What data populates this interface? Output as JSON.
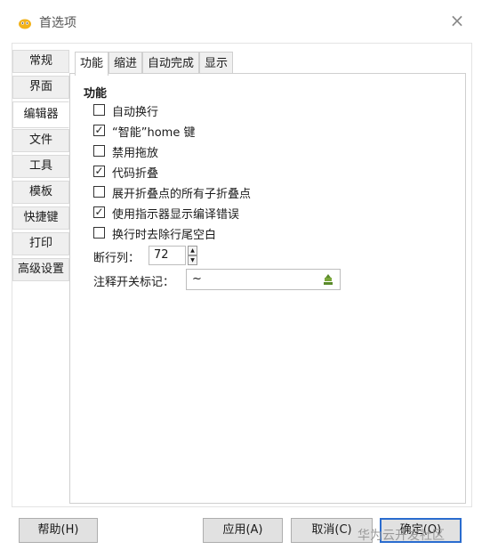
{
  "window": {
    "title": "首选项"
  },
  "sidebar": {
    "items": [
      {
        "label": "常规"
      },
      {
        "label": "界面"
      },
      {
        "label": "编辑器",
        "active": true
      },
      {
        "label": "文件"
      },
      {
        "label": "工具"
      },
      {
        "label": "模板"
      },
      {
        "label": "快捷键"
      },
      {
        "label": "打印"
      },
      {
        "label": "高级设置"
      }
    ]
  },
  "tabs": [
    {
      "label": "功能",
      "active": true
    },
    {
      "label": "缩进"
    },
    {
      "label": "自动完成"
    },
    {
      "label": "显示"
    }
  ],
  "section": {
    "title": "功能"
  },
  "options": [
    {
      "label": "自动换行",
      "checked": false
    },
    {
      "label": "“智能”home 键",
      "checked": true
    },
    {
      "label": "禁用拖放",
      "checked": false
    },
    {
      "label": "代码折叠",
      "checked": true
    },
    {
      "label": "展开折叠点的所有子折叠点",
      "checked": false
    },
    {
      "label": "使用指示器显示编译错误",
      "checked": true
    },
    {
      "label": "换行时去除行尾空白",
      "checked": false
    }
  ],
  "line_break": {
    "label": "断行列：",
    "value": "72"
  },
  "comment_marker": {
    "label": "注释开关标记：",
    "value": "~"
  },
  "buttons": {
    "help": "帮助(H)",
    "apply": "应用(A)",
    "cancel": "取消(C)",
    "ok": "确定(O)"
  },
  "watermark": "华为云开发社区",
  "colors": {
    "accent": "#2a6ccf",
    "check": "#222222"
  }
}
